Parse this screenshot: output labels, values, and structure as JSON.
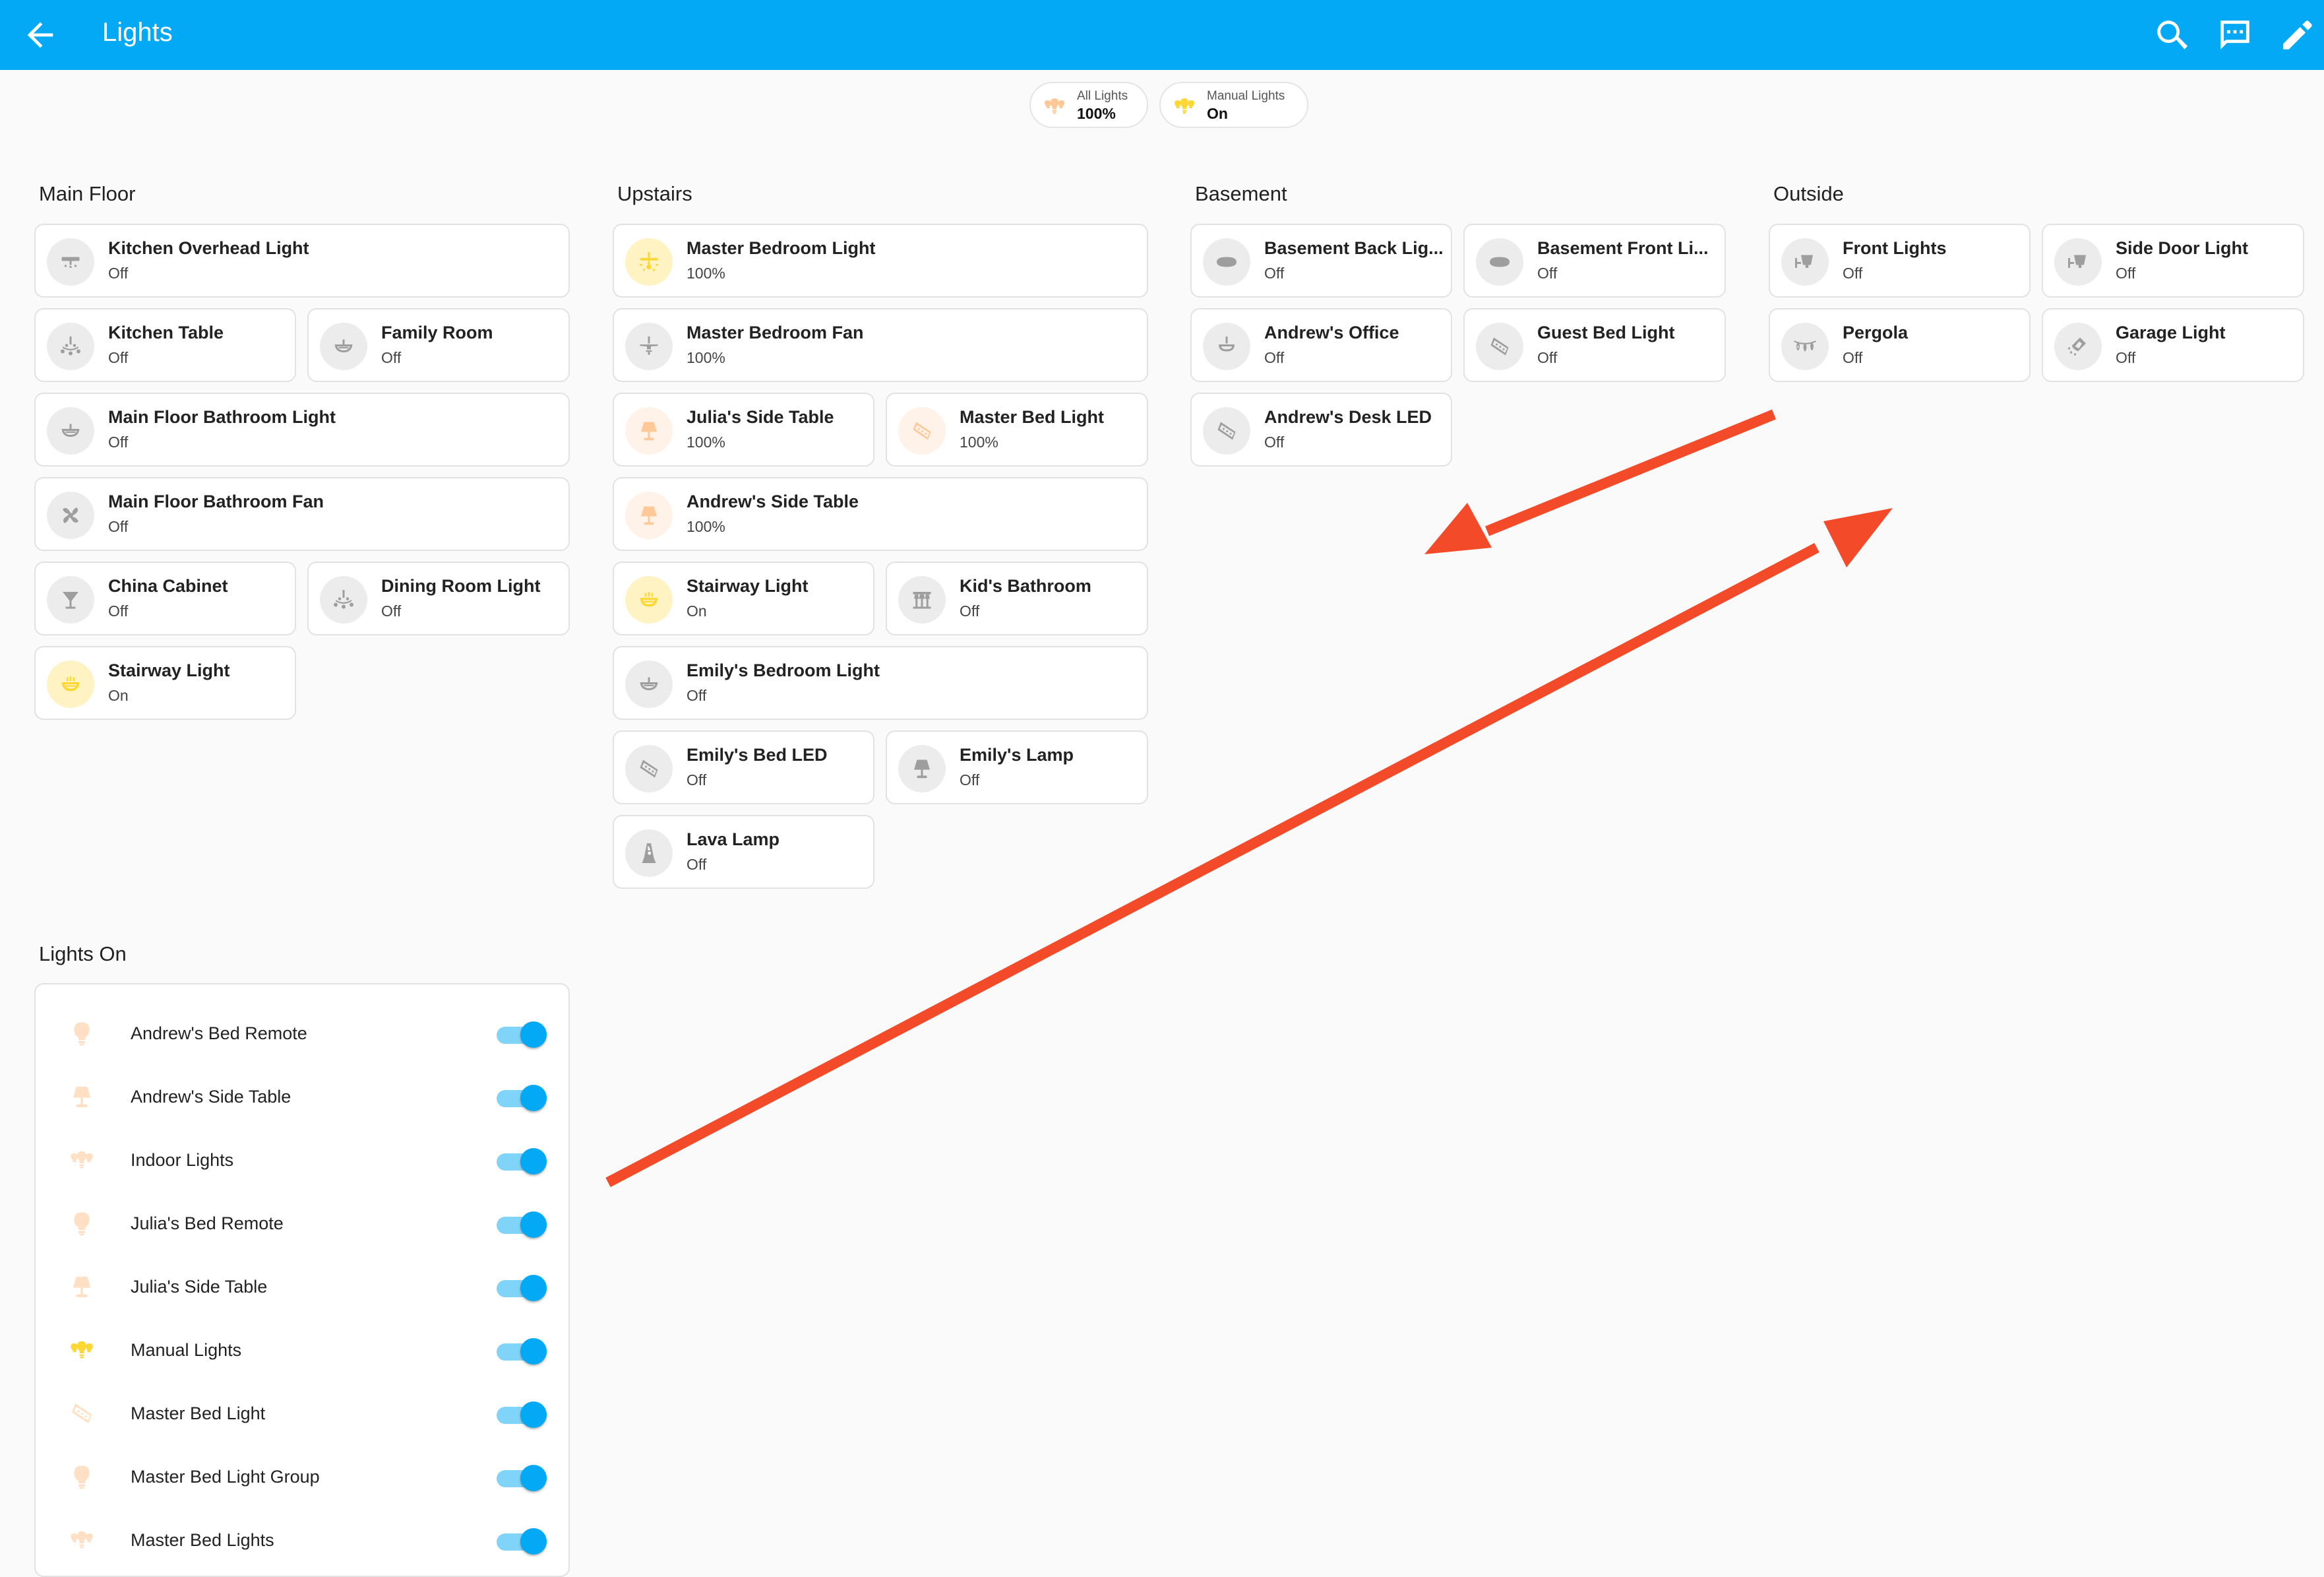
{
  "header": {
    "title": "Lights"
  },
  "badges": [
    {
      "name": "All Lights",
      "state": "100%"
    },
    {
      "name": "Manual Lights",
      "state": "On"
    }
  ],
  "sections": {
    "main_floor": {
      "title": "Main Floor",
      "cards": [
        {
          "name": "Kitchen Overhead Light",
          "state": "Off"
        },
        {
          "name": "Kitchen Table",
          "state": "Off"
        },
        {
          "name": "Family Room",
          "state": "Off"
        },
        {
          "name": "Main Floor Bathroom Light",
          "state": "Off"
        },
        {
          "name": "Main Floor Bathroom Fan",
          "state": "Off"
        },
        {
          "name": "China Cabinet",
          "state": "Off"
        },
        {
          "name": "Dining Room Light",
          "state": "Off"
        },
        {
          "name": "Stairway Light",
          "state": "On"
        }
      ]
    },
    "upstairs": {
      "title": "Upstairs",
      "cards": [
        {
          "name": "Master Bedroom Light",
          "state": "100%"
        },
        {
          "name": "Master Bedroom Fan",
          "state": "100%"
        },
        {
          "name": "Julia's Side Table",
          "state": "100%"
        },
        {
          "name": "Master Bed Light",
          "state": "100%"
        },
        {
          "name": "Andrew's Side Table",
          "state": "100%"
        },
        {
          "name": "Stairway Light",
          "state": "On"
        },
        {
          "name": "Kid's Bathroom",
          "state": "Off"
        },
        {
          "name": "Emily's Bedroom Light",
          "state": "Off"
        },
        {
          "name": "Emily's Bed LED",
          "state": "Off"
        },
        {
          "name": "Emily's Lamp",
          "state": "Off"
        },
        {
          "name": "Lava Lamp",
          "state": "Off"
        }
      ]
    },
    "basement": {
      "title": "Basement",
      "cards": [
        {
          "name": "Basement Back Lig...",
          "state": "Off"
        },
        {
          "name": "Basement Front Li...",
          "state": "Off"
        },
        {
          "name": "Andrew's Office",
          "state": "Off"
        },
        {
          "name": "Guest Bed Light",
          "state": "Off"
        },
        {
          "name": "Andrew's Desk LED",
          "state": "Off"
        }
      ]
    },
    "outside": {
      "title": "Outside",
      "cards": [
        {
          "name": "Front Lights",
          "state": "Off"
        },
        {
          "name": "Side Door Light",
          "state": "Off"
        },
        {
          "name": "Pergola",
          "state": "Off"
        },
        {
          "name": "Garage Light",
          "state": "Off"
        }
      ]
    }
  },
  "lights_on": {
    "title": "Lights On",
    "rows": [
      {
        "label": "Andrew's Bed Remote",
        "icon": "bulb-icon"
      },
      {
        "label": "Andrew's Side Table",
        "icon": "lamp-icon"
      },
      {
        "label": "Indoor Lights",
        "icon": "lightbulb-group-icon"
      },
      {
        "label": "Julia's Bed Remote",
        "icon": "bulb-icon"
      },
      {
        "label": "Julia's Side Table",
        "icon": "lamp-icon"
      },
      {
        "label": "Manual Lights",
        "icon": "lightbulb-group-icon"
      },
      {
        "label": "Master Bed Light",
        "icon": "led-strip-icon"
      },
      {
        "label": "Master Bed Light Group",
        "icon": "bulb-icon"
      },
      {
        "label": "Master Bed Lights",
        "icon": "lightbulb-group-icon"
      }
    ]
  },
  "colors": {
    "header": "#03a9f4",
    "on_icon": "#fdd835",
    "on_circle": "#fff3c4",
    "dim_on_icon": "#ffc896",
    "dim_on_circle": "#fff3e9",
    "off_icon": "#9e9e9e",
    "toggle": "#03a9f4",
    "annotation_arrow": "#f34a2a"
  }
}
